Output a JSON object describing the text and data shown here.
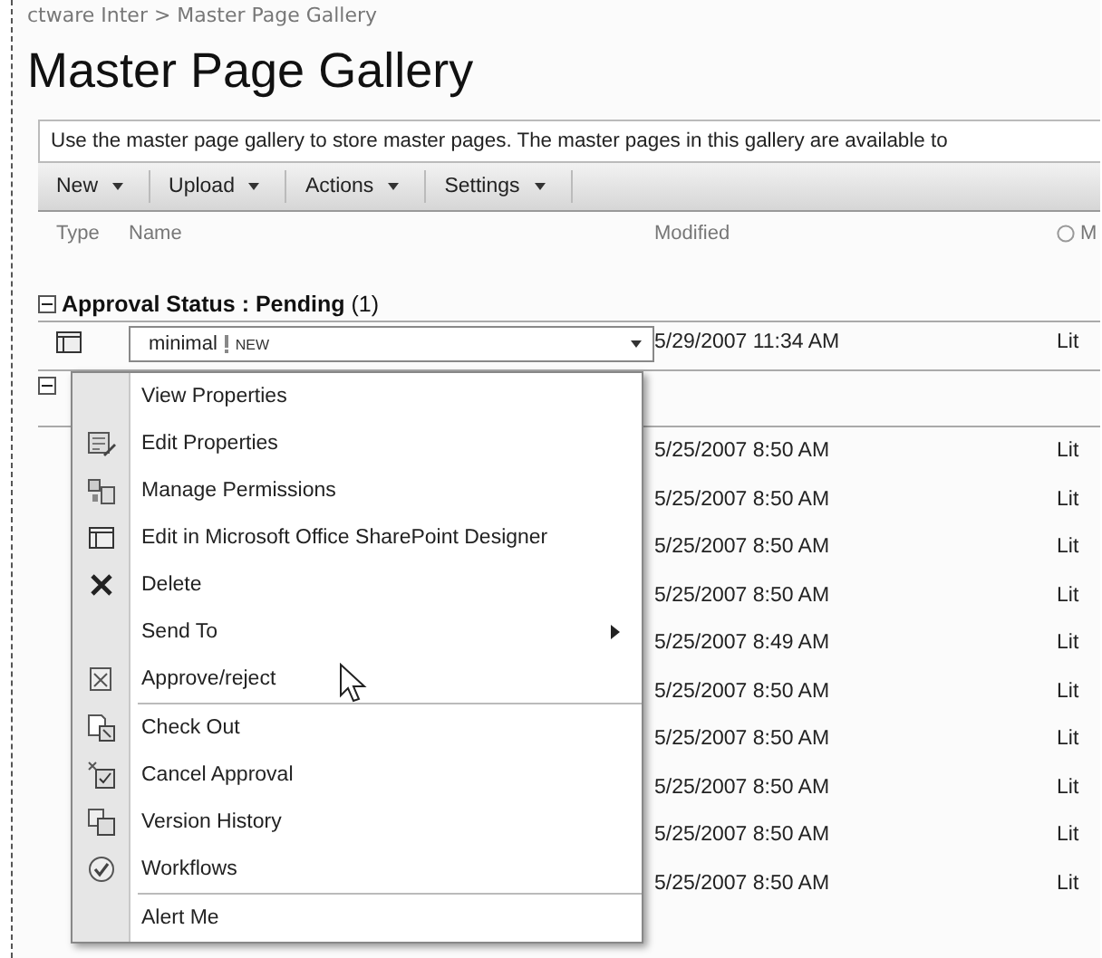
{
  "breadcrumb": "ctware Inter > Master Page Gallery",
  "title": "Master Page Gallery",
  "description": "Use the master page gallery to store master pages. The master pages in this gallery are available to",
  "toolbar": [
    {
      "label": "New"
    },
    {
      "label": "Upload"
    },
    {
      "label": "Actions"
    },
    {
      "label": "Settings"
    }
  ],
  "columns": [
    "Type",
    "Name",
    "Modified",
    "M"
  ],
  "groups": [
    {
      "label": "**Approval Status : Pending** (1)",
      "expanded": true,
      "items": [
        {
          "name": "minimal",
          "badge": "NEW",
          "modified": "5/29/2007 11:34 AM",
          "column_4": "Lit"
        }
      ]
    },
    {
      "expanded": true,
      "items": [
        {
          "modified": "5/25/2007 8:50 AM",
          "column_4": "Lit"
        },
        {
          "modified": "5/25/2007 8:50 AM",
          "column_4": "Lit"
        },
        {
          "modified": "5/25/2007 8:50 AM",
          "column_4": "Lit"
        },
        {
          "modified": "5/25/2007 8:50 AM",
          "column_4": "Lit"
        },
        {
          "modified": "5/25/2007 8:49 AM",
          "column_4": "Lit"
        },
        {
          "modified": "5/25/2007 8:50 AM",
          "column_4": "Lit"
        },
        {
          "modified": "5/25/2007 8:50 AM",
          "column_4": "Lit"
        },
        {
          "modified": "5/25/2007 8:50 AM",
          "column_4": "Lit"
        },
        {
          "modified": "5/25/2007 8:50 AM",
          "column_4": "Lit"
        },
        {
          "modified": "5/25/2007 8:50 AM",
          "column_4": "Lit"
        }
      ]
    }
  ],
  "menu": {
    "sections": [
      [
        {
          "label": "View Properties",
          "kind": "command"
        },
        {
          "label": "Edit Properties",
          "kind": "command"
        },
        {
          "label": "Manage Permissions",
          "kind": "command"
        },
        {
          "label": "Edit in Microsoft Office SharePoint Designer",
          "kind": "command"
        },
        {
          "label": "Delete",
          "kind": "command"
        },
        {
          "label": "Send To",
          "kind": "submenu"
        },
        {
          "label": "Approve/reject",
          "kind": "command"
        }
      ],
      [
        {
          "label": "Check Out",
          "kind": "command"
        },
        {
          "label": "Cancel Approval",
          "kind": "command"
        },
        {
          "label": "Version History",
          "kind": "command"
        },
        {
          "label": "Workflows",
          "kind": "command"
        }
      ],
      [
        {
          "label": "Alert Me",
          "kind": "command"
        }
      ]
    ]
  }
}
